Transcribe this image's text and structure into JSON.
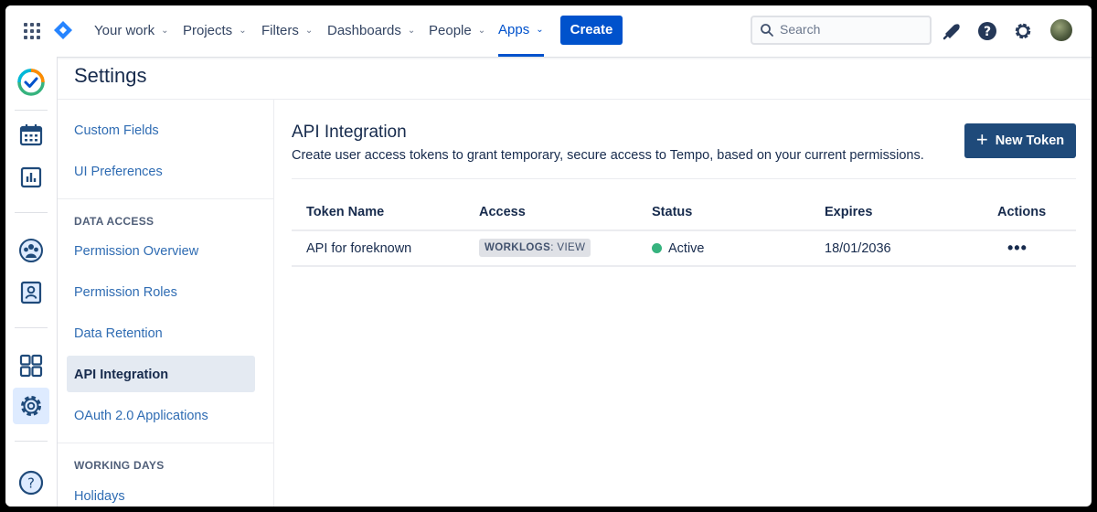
{
  "nav": {
    "items": [
      {
        "label": "Your work"
      },
      {
        "label": "Projects"
      },
      {
        "label": "Filters"
      },
      {
        "label": "Dashboards"
      },
      {
        "label": "People"
      },
      {
        "label": "Apps",
        "active": true
      }
    ],
    "create_label": "Create",
    "search_placeholder": "Search",
    "accent_color": "#0052cc"
  },
  "rail": {
    "icons": [
      "tempo-logo-icon",
      "calendar-icon",
      "reports-icon",
      "teams-icon",
      "user-card-icon",
      "apps-grid-icon",
      "gear-icon",
      "help-icon"
    ],
    "selected": "gear-icon"
  },
  "settings": {
    "title": "Settings",
    "sidebar": {
      "links_top": [
        "Custom Fields",
        "UI Preferences"
      ],
      "data_access_heading": "DATA ACCESS",
      "data_access_links": [
        "Permission Overview",
        "Permission Roles",
        "Data Retention",
        "API Integration",
        "OAuth 2.0 Applications"
      ],
      "selected": "API Integration",
      "working_days_heading": "WORKING DAYS",
      "working_days_links": [
        "Holidays"
      ]
    }
  },
  "main": {
    "title": "API Integration",
    "description": "Create user access tokens to grant temporary, secure access to Tempo, based on your current permissions.",
    "new_token_label": "New Token",
    "button_color": "#1f4a7a",
    "table": {
      "headers": [
        "Token Name",
        "Access",
        "Status",
        "Expires",
        "Actions"
      ],
      "rows": [
        {
          "name": "API for foreknown",
          "access_scope": "WORKLOGS",
          "access_level": ": VIEW",
          "status": "Active",
          "status_color": "#36b37e",
          "expires": "18/01/2036",
          "actions": "•••"
        }
      ]
    }
  }
}
